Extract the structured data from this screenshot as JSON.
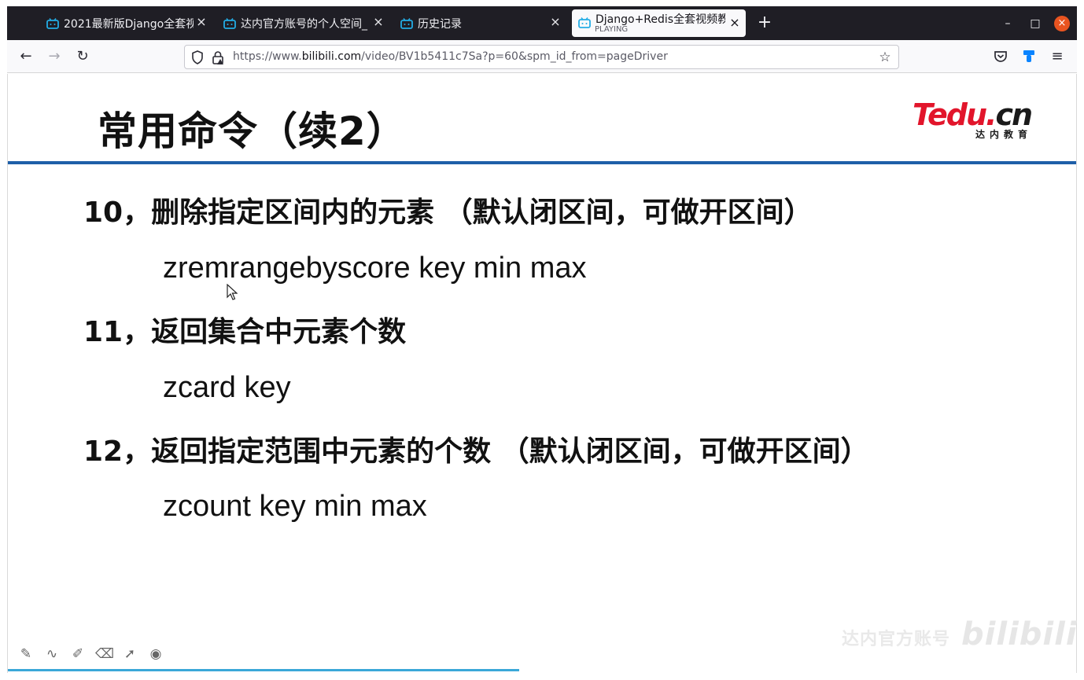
{
  "browser": {
    "tabs": [
      {
        "title": "2021最新版Django全套视",
        "icon": "bilibili-tv-icon"
      },
      {
        "title": "达内官方账号的个人空间_",
        "icon": "bilibili-tv-icon"
      },
      {
        "title": "历史记录",
        "icon": "bilibili-tv-icon"
      },
      {
        "title": "Django+Redis全套视频教",
        "subtitle": "PLAYING",
        "icon": "bilibili-tv-icon"
      }
    ],
    "new_tab": "+",
    "window_controls": {
      "minimize": "–",
      "maximize": "□",
      "close": "×"
    },
    "url": {
      "prefix": "https://www.",
      "domain": "bilibili.com",
      "path": "/video/BV1b5411c7Sa?p=60&spm_id_from=pageDriver"
    }
  },
  "slide": {
    "title": "常用命令（续2）",
    "logo": {
      "main": "Tedu.",
      "accent": "cn",
      "sub": "达内教育"
    },
    "items": [
      {
        "heading": "10，删除指定区间内的元素 （默认闭区间，可做开区间）",
        "command": "zremrangebyscore key min max"
      },
      {
        "heading": "11，返回集合中元素个数",
        "command": "zcard key"
      },
      {
        "heading": "12，返回指定范围中元素的个数 （默认闭区间，可做开区间）",
        "command": "zcount key min max"
      }
    ],
    "watermark": {
      "text": "达内官方账号",
      "logo": "bilibili"
    }
  },
  "tools": [
    "pen-icon",
    "curve-icon",
    "highlighter-icon",
    "eraser-icon",
    "pointer-icon",
    "record-icon"
  ],
  "colors": {
    "accent_blue": "#1f5fa8",
    "logo_red": "#e2152b",
    "tab_bg": "#1f1e25",
    "progress": "#3aa8d8"
  }
}
